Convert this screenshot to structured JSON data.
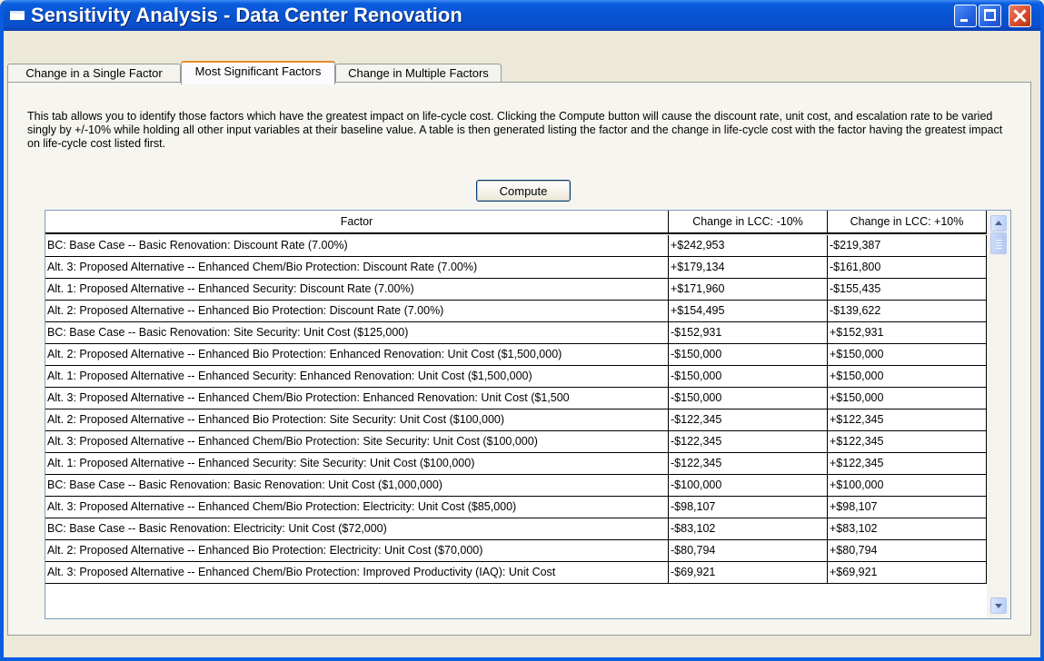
{
  "window": {
    "title": "Sensitivity Analysis - Data Center Renovation"
  },
  "tabs": [
    {
      "label": "Change in a Single Factor",
      "active": false
    },
    {
      "label": "Most Significant Factors",
      "active": true
    },
    {
      "label": "Change in Multiple Factors",
      "active": false
    }
  ],
  "description": "This tab allows you to identify those factors which have the greatest impact on life-cycle cost. Clicking the Compute button will cause the discount rate, unit cost, and escalation rate to be varied singly by +/-10% while holding all other input variables at their baseline value. A table is then generated listing the factor and the change in life-cycle cost with the factor having the greatest impact on life-cycle cost listed first.",
  "compute_label": "Compute",
  "table": {
    "columns": [
      "Factor",
      "Change in LCC: -10%",
      "Change in LCC: +10%"
    ],
    "rows": [
      [
        "BC: Base Case -- Basic Renovation: Discount Rate (7.00%)",
        "+$242,953",
        "-$219,387"
      ],
      [
        "Alt. 3: Proposed Alternative -- Enhanced Chem/Bio Protection: Discount Rate (7.00%)",
        "+$179,134",
        "-$161,800"
      ],
      [
        "Alt. 1: Proposed Alternative -- Enhanced Security: Discount Rate (7.00%)",
        "+$171,960",
        "-$155,435"
      ],
      [
        "Alt. 2: Proposed Alternative -- Enhanced Bio Protection: Discount Rate (7.00%)",
        "+$154,495",
        "-$139,622"
      ],
      [
        "BC: Base Case -- Basic Renovation: Site Security: Unit Cost ($125,000)",
        "-$152,931",
        "+$152,931"
      ],
      [
        "Alt. 2: Proposed Alternative -- Enhanced Bio Protection: Enhanced Renovation: Unit Cost ($1,500,000)",
        "-$150,000",
        "+$150,000"
      ],
      [
        "Alt. 1: Proposed Alternative -- Enhanced Security: Enhanced Renovation: Unit Cost ($1,500,000)",
        "-$150,000",
        "+$150,000"
      ],
      [
        "Alt. 3: Proposed Alternative -- Enhanced Chem/Bio Protection: Enhanced Renovation: Unit Cost ($1,500",
        "-$150,000",
        "+$150,000"
      ],
      [
        "Alt. 2: Proposed Alternative -- Enhanced Bio Protection: Site Security: Unit Cost ($100,000)",
        "-$122,345",
        "+$122,345"
      ],
      [
        "Alt. 3: Proposed Alternative -- Enhanced Chem/Bio Protection: Site Security: Unit Cost ($100,000)",
        "-$122,345",
        "+$122,345"
      ],
      [
        "Alt. 1: Proposed Alternative -- Enhanced Security: Site Security: Unit Cost ($100,000)",
        "-$122,345",
        "+$122,345"
      ],
      [
        "BC: Base Case -- Basic Renovation: Basic Renovation: Unit Cost ($1,000,000)",
        "-$100,000",
        "+$100,000"
      ],
      [
        "Alt. 3: Proposed Alternative -- Enhanced Chem/Bio Protection: Electricity: Unit Cost ($85,000)",
        "-$98,107",
        "+$98,107"
      ],
      [
        "BC: Base Case -- Basic Renovation: Electricity: Unit Cost ($72,000)",
        "-$83,102",
        "+$83,102"
      ],
      [
        "Alt. 2: Proposed Alternative -- Enhanced Bio Protection: Electricity: Unit Cost ($70,000)",
        "-$80,794",
        "+$80,794"
      ],
      [
        "Alt. 3: Proposed Alternative -- Enhanced Chem/Bio Protection: Improved Productivity (IAQ): Unit Cost",
        "-$69,921",
        "+$69,921"
      ]
    ]
  },
  "icons": {
    "window": "window-app-icon",
    "minimize": "minimize-icon",
    "maximize": "maximize-icon",
    "close": "close-icon",
    "scroll_up": "scroll-up-arrow-icon",
    "scroll_down": "scroll-down-arrow-icon"
  },
  "colors": {
    "titlebar": "#0a5ce0",
    "window_bg": "#ece9d8",
    "active_tab_accent": "#e68b2c",
    "close_button": "#d44a2a"
  }
}
